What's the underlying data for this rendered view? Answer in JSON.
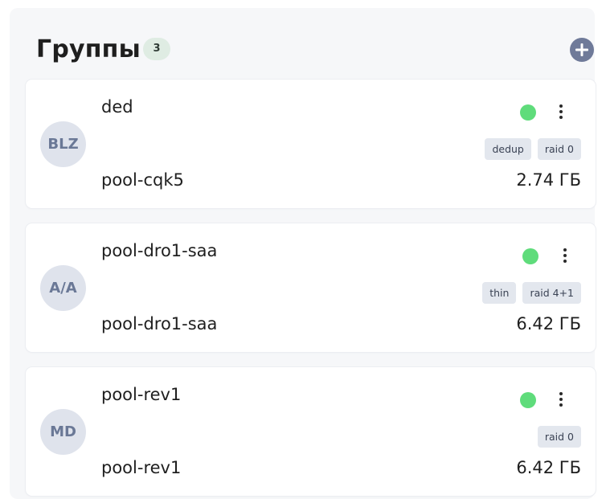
{
  "header": {
    "title": "Группы",
    "count": "3",
    "add_icon": "plus-circle-icon"
  },
  "groups": [
    {
      "avatar": "BLZ",
      "name": "ded",
      "pool": "pool-cqk5",
      "size": "2.74 ГБ",
      "status_color": "#5fdc7b",
      "tags": [
        "dedup",
        "raid 0"
      ]
    },
    {
      "avatar": "A/A",
      "name": "pool-dro1-saa",
      "pool": "pool-dro1-saa",
      "size": "6.42 ГБ",
      "status_color": "#5fdc7b",
      "tags": [
        "thin",
        "raid 4+1"
      ]
    },
    {
      "avatar": "MD",
      "name": "pool-rev1",
      "pool": "pool-rev1",
      "size": "6.42 ГБ",
      "status_color": "#5fdc7b",
      "tags": [
        "raid 0"
      ]
    }
  ],
  "colors": {
    "avatar_bg": "#dfe3ec",
    "avatar_text": "#6a7896",
    "add_button": "#6f7a99",
    "tag_bg": "#e3e7ee",
    "count_badge_bg": "#dfece3"
  }
}
